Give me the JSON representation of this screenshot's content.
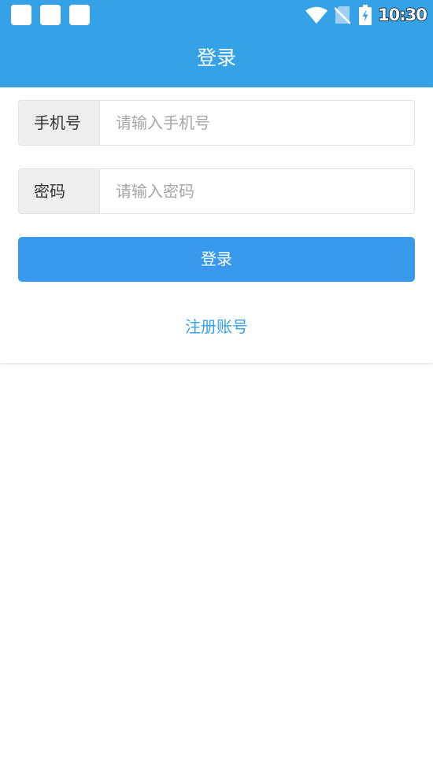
{
  "status_bar": {
    "time": "10:30",
    "notification_icons": [
      "app-notification-icon",
      "app-notification-icon",
      "app-notification-icon"
    ],
    "wifi_icon": "wifi-icon",
    "sim_icon": "no-sim-icon",
    "battery_icon": "battery-charging-icon"
  },
  "header": {
    "title": "登录"
  },
  "form": {
    "phone": {
      "label": "手机号",
      "value": "",
      "placeholder": "请输入手机号"
    },
    "password": {
      "label": "密码",
      "value": "",
      "placeholder": "请输入密码"
    },
    "login_label": "登录",
    "register_label": "注册账号"
  },
  "colors": {
    "header_blue": "#35a2e8",
    "button_blue": "#3999ec",
    "link_blue": "#35a2e8",
    "label_bg": "#eeeeee",
    "placeholder": "#a6a6a6"
  }
}
